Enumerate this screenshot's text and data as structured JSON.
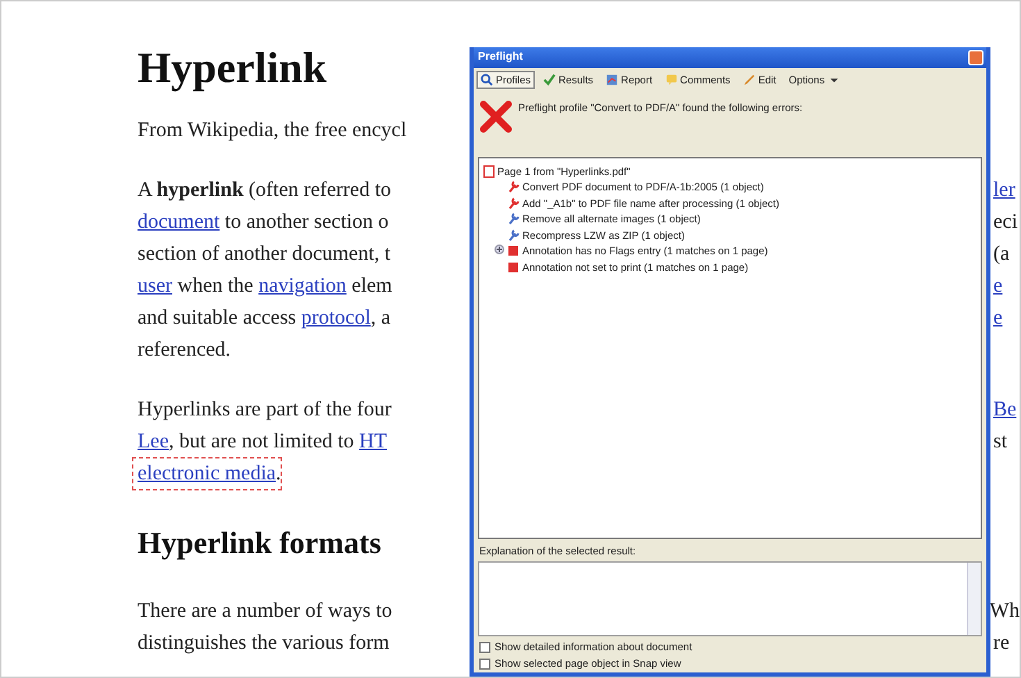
{
  "document": {
    "title": "Hyperlink",
    "blocks": [
      {
        "kind": "subtitle",
        "lines": [
          {
            "left": [
              {
                "text": "From Wikipedia, the free encycl",
                "link": false
              }
            ]
          }
        ]
      },
      {
        "kind": "para",
        "lines": [
          {
            "left": [
              {
                "text": "A **hyperlink** (often referred to",
                "link": false
              }
            ],
            "right": [
              {
                "text": "ler",
                "link": true
              }
            ]
          },
          {
            "left": [
              {
                "text": "document",
                "link": true
              },
              {
                "text": " to another section o",
                "link": false
              }
            ],
            "right": [
              {
                "text": "eci",
                "link": false
              }
            ]
          },
          {
            "left": [
              {
                "text": "section of another document, t",
                "link": false
              }
            ],
            "right": [
              {
                "text": "(a",
                "link": false
              }
            ]
          },
          {
            "left": [
              {
                "text": "user",
                "link": true
              },
              {
                "text": " when the ",
                "link": false
              },
              {
                "text": "navigation",
                "link": true
              },
              {
                "text": " elem",
                "link": false
              }
            ],
            "right": [
              {
                "text": "e",
                "link": true
              }
            ]
          },
          {
            "left": [
              {
                "text": "and suitable access ",
                "link": false
              },
              {
                "text": "protocol",
                "link": true
              },
              {
                "text": ", a",
                "link": false
              }
            ],
            "right": [
              {
                "text": "e",
                "link": true
              }
            ]
          },
          {
            "left": [
              {
                "text": "referenced.",
                "link": false
              }
            ]
          }
        ]
      },
      {
        "kind": "para",
        "lines": [
          {
            "left": [
              {
                "text": "Hyperlinks are part of the four",
                "link": false
              }
            ],
            "right": [
              {
                "text": "Be",
                "link": true
              }
            ]
          },
          {
            "left": [
              {
                "text": "Lee",
                "link": true
              },
              {
                "text": ", but are not limited to ",
                "link": false
              },
              {
                "text": "HT",
                "link": true
              }
            ],
            "right": [
              {
                "text": "st",
                "link": false
              }
            ]
          },
          {
            "left": [
              {
                "text": "electronic media",
                "link": true,
                "highlighted": true
              },
              {
                "text": ".",
                "link": false
              }
            ]
          }
        ]
      },
      {
        "kind": "heading",
        "lines": [
          {
            "left": [
              {
                "text": "Hyperlink formats",
                "link": false
              }
            ]
          }
        ]
      },
      {
        "kind": "para",
        "lines": [
          {
            "left": [
              {
                "text": "There are a number of ways to",
                "link": false
              }
            ],
            "right": [
              {
                "text": "Wh",
                "link": false
              }
            ]
          },
          {
            "left": [
              {
                "text": "distinguishes the various form",
                "link": false
              }
            ],
            "right": [
              {
                "text": "re",
                "link": false
              }
            ]
          }
        ]
      }
    ]
  },
  "dialog": {
    "title": "Preflight",
    "toolbar": [
      {
        "label": "Profiles",
        "selected": true
      },
      {
        "label": "Results",
        "selected": false
      },
      {
        "label": "Report",
        "selected": false
      },
      {
        "label": "Comments",
        "selected": false
      },
      {
        "label": "Edit",
        "selected": false
      },
      {
        "label": "Options",
        "selected": false
      }
    ],
    "message": "Preflight profile \"Convert to PDF/A\" found the following errors:",
    "tree": {
      "label": "Page 1 from \"Hyperlinks.pdf\"",
      "children": [
        {
          "label": "Convert PDF document to PDF/A-1b:2005 (1 object)",
          "kind": "failed"
        },
        {
          "label": "Add \"_A1b\" to PDF file name after processing (1 object)",
          "kind": "failed"
        },
        {
          "label": "Remove all alternate images (1 object)",
          "kind": "applied"
        },
        {
          "label": "Recompress LZW as ZIP (1 object)",
          "kind": "applied"
        },
        {
          "label": "Annotation has no Flags entry (1 matches on 1 page)",
          "kind": "error",
          "expanded": false
        },
        {
          "label": "Annotation not set to print (1 matches on 1 page)",
          "kind": "error"
        }
      ]
    },
    "explanation_label": "Explanation of the selected result:",
    "checkboxes": [
      {
        "label": "Show detailed information about document",
        "checked": false
      },
      {
        "label": "Show selected page object in Snap view",
        "checked": false
      }
    ]
  }
}
